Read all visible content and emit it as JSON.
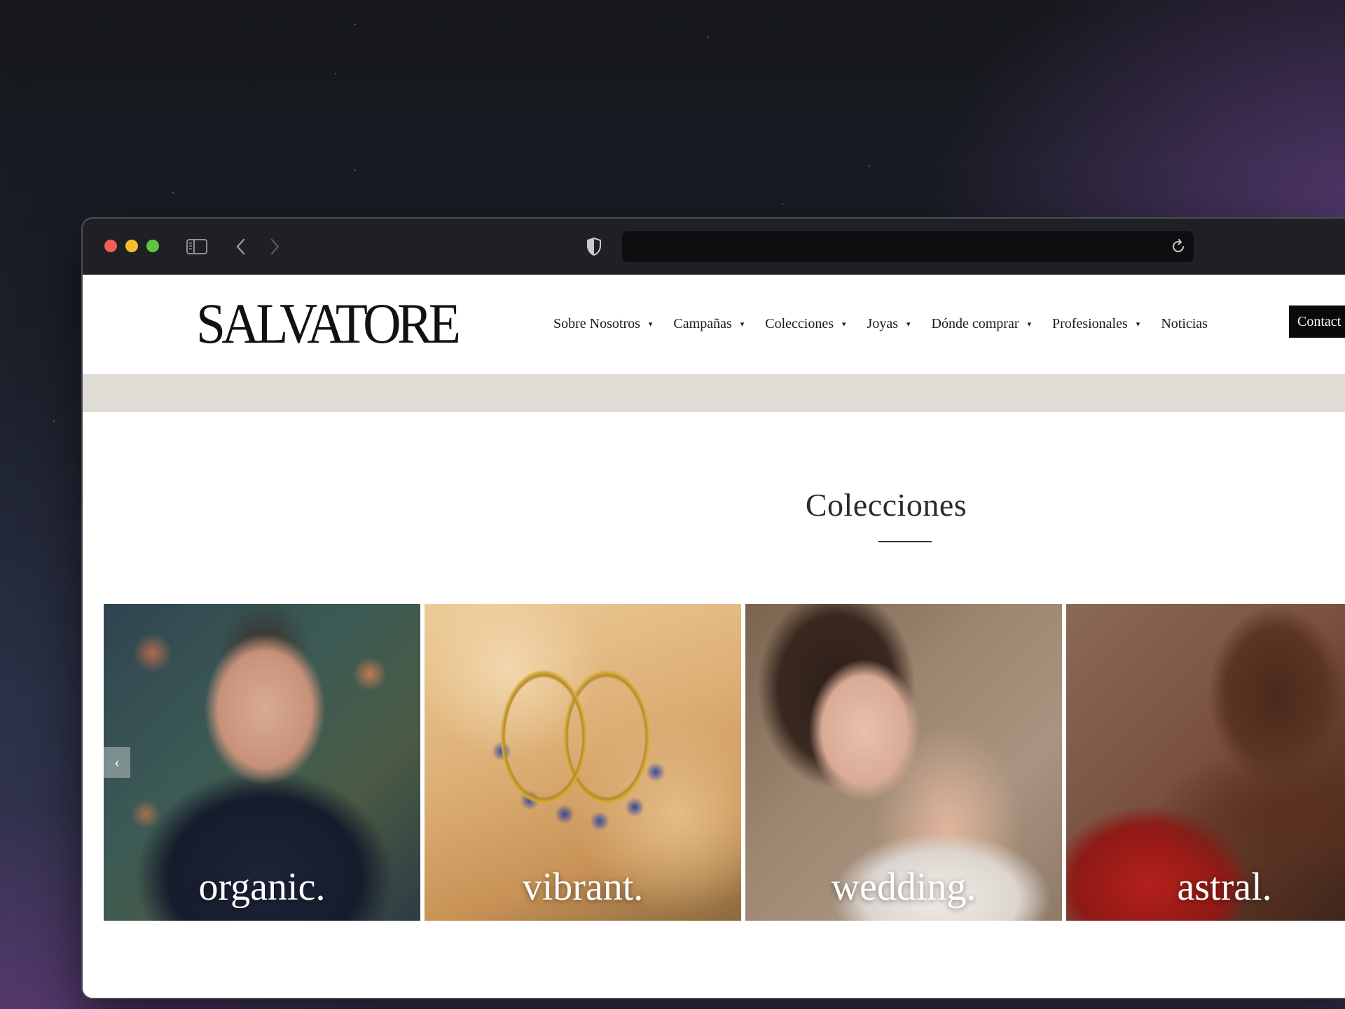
{
  "browser": {
    "controls": {
      "close": "close",
      "minimize": "minimize",
      "zoom": "zoom"
    },
    "icons": {
      "sidebar": "sidebar-icon",
      "back": "chevron-left-icon",
      "forward": "chevron-right-icon",
      "privacy": "shield-icon",
      "reload": "reload-icon"
    },
    "address_value": ""
  },
  "site": {
    "logo": "SALVATORE",
    "nav": [
      {
        "label": "Sobre Nosotros",
        "has_dropdown": true
      },
      {
        "label": "Campañas",
        "has_dropdown": true
      },
      {
        "label": "Colecciones",
        "has_dropdown": true
      },
      {
        "label": "Joyas",
        "has_dropdown": true
      },
      {
        "label": "Dónde comprar",
        "has_dropdown": true
      },
      {
        "label": "Profesionales",
        "has_dropdown": true
      },
      {
        "label": "Noticias",
        "has_dropdown": false
      }
    ],
    "contact_label": "Contact",
    "caret": "▾"
  },
  "collections": {
    "title": "Colecciones",
    "prev_arrow": "‹",
    "items": [
      {
        "label": "organic."
      },
      {
        "label": "vibrant."
      },
      {
        "label": "wedding."
      },
      {
        "label": "astral."
      }
    ]
  },
  "colors": {
    "band": "#dedcd5",
    "contact_bg": "#0a0a0a",
    "titlebar": "#1f2023"
  }
}
